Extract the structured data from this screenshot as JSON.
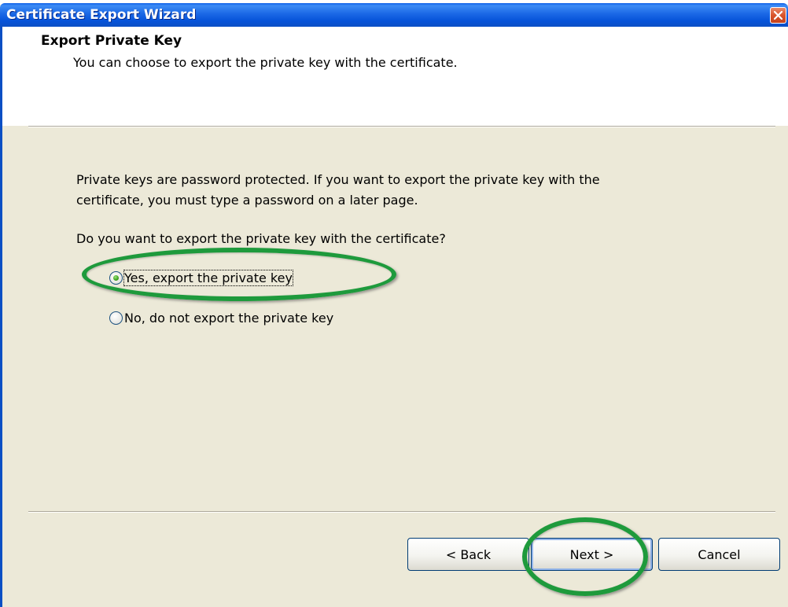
{
  "window": {
    "title": "Certificate Export Wizard"
  },
  "header": {
    "title": "Export Private Key",
    "subtitle": "You can choose to export the private key with the certificate."
  },
  "body": {
    "paragraph_line1": "Private keys are password protected. If you want to export the private key with the",
    "paragraph_line2": "certificate, you must type a password on a later page.",
    "question": "Do you want to export the private key with the certificate?"
  },
  "options": [
    {
      "label": "Yes, export the private key",
      "checked": true
    },
    {
      "label": "No, do not export the private key",
      "checked": false
    }
  ],
  "buttons": {
    "back": "< Back",
    "next": "Next >",
    "cancel": "Cancel"
  },
  "colors": {
    "titlebar": "#0653d9",
    "dialog_background": "#ece9d8",
    "highlight_ring": "#1e9a3c",
    "close_button": "#d9552c"
  },
  "icons": {
    "close": "close-icon"
  }
}
